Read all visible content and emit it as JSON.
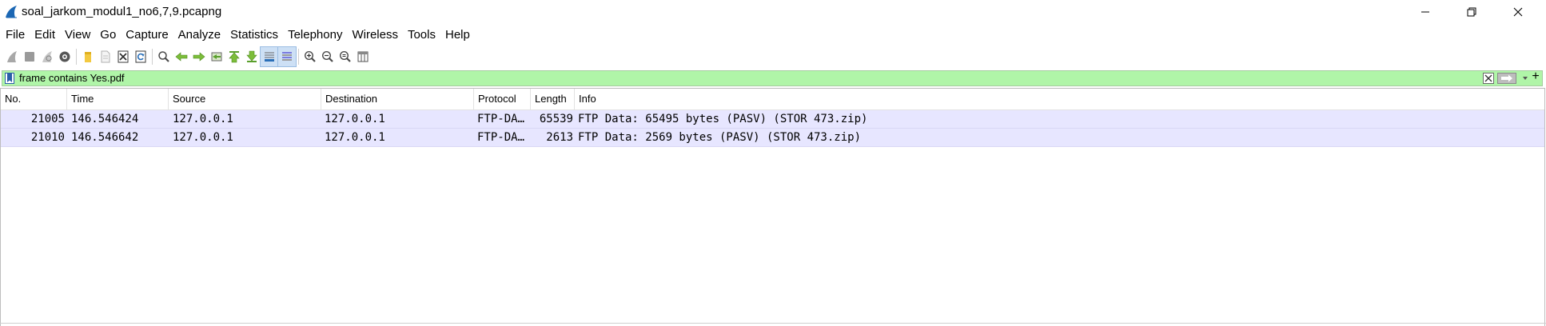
{
  "window": {
    "title": "soal_jarkom_modul1_no6,7,9.pcapng"
  },
  "menu": [
    "File",
    "Edit",
    "View",
    "Go",
    "Capture",
    "Analyze",
    "Statistics",
    "Telephony",
    "Wireless",
    "Tools",
    "Help"
  ],
  "toolbar_icons": [
    "start-capture-icon",
    "stop-capture-icon",
    "restart-capture-icon",
    "capture-options-icon",
    "open-file-icon",
    "save-file-icon",
    "close-file-icon",
    "reload-file-icon",
    "find-packet-icon",
    "go-back-icon",
    "go-forward-icon",
    "go-to-packet-icon",
    "first-packet-icon",
    "last-packet-icon",
    "autoscroll-icon",
    "colorize-icon",
    "zoom-in-icon",
    "zoom-out-icon",
    "normal-size-icon",
    "resize-columns-icon"
  ],
  "filter": {
    "value": "frame contains Yes.pdf",
    "color": "#b0f5a8"
  },
  "packet_list": {
    "columns": [
      "No.",
      "Time",
      "Source",
      "Destination",
      "Protocol",
      "Length",
      "Info"
    ],
    "rows": [
      {
        "no": "21005",
        "time": "146.546424",
        "source": "127.0.0.1",
        "destination": "127.0.0.1",
        "protocol": "FTP-DA…",
        "length": "65539",
        "info": "FTP Data: 65495 bytes (PASV) (STOR 473.zip)"
      },
      {
        "no": "21010",
        "time": "146.546642",
        "source": "127.0.0.1",
        "destination": "127.0.0.1",
        "protocol": "FTP-DA…",
        "length": "2613",
        "info": "FTP Data: 2569 bytes (PASV) (STOR 473.zip)"
      }
    ],
    "row_color": "#e7e6ff"
  }
}
